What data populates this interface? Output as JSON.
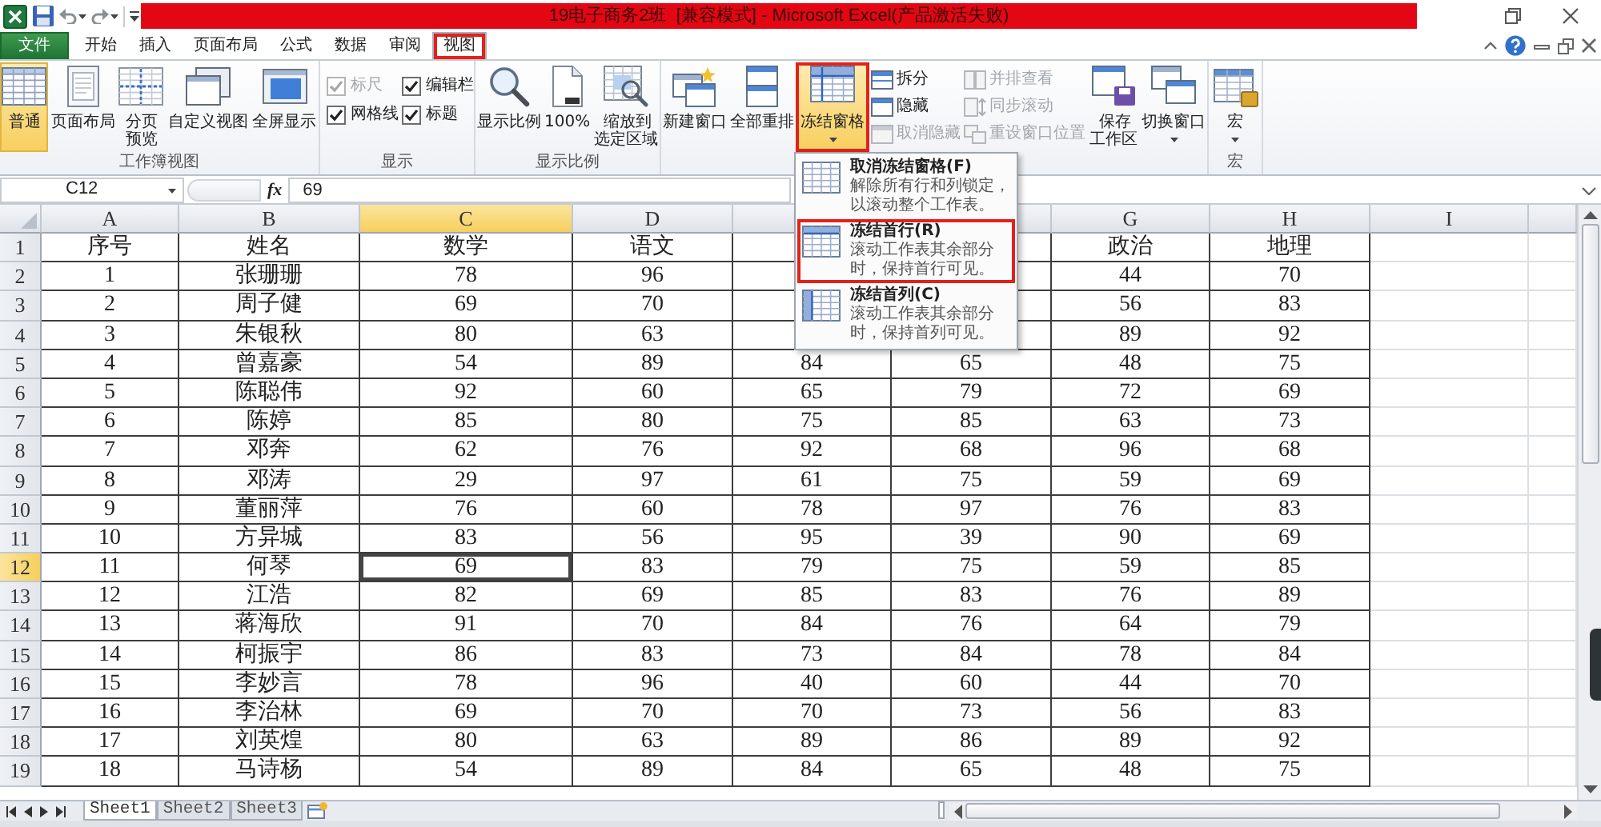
{
  "title_bar": {
    "title": "19电子商务2班  [兼容模式] - Microsoft Excel(产品激活失败)"
  },
  "ribbon_tabs": [
    {
      "kind": "file",
      "label": "文件",
      "selected": false,
      "annotated": false
    },
    {
      "kind": "tab",
      "label": "开始",
      "selected": false,
      "annotated": false
    },
    {
      "kind": "tab",
      "label": "插入",
      "selected": false,
      "annotated": false
    },
    {
      "kind": "tab",
      "label": "页面布局",
      "selected": false,
      "annotated": false
    },
    {
      "kind": "tab",
      "label": "公式",
      "selected": false,
      "annotated": false
    },
    {
      "kind": "tab",
      "label": "数据",
      "selected": false,
      "annotated": false
    },
    {
      "kind": "tab",
      "label": "审阅",
      "selected": false,
      "annotated": false
    },
    {
      "kind": "tab",
      "label": "视图",
      "selected": true,
      "annotated": true
    }
  ],
  "ribbon_groups": [
    {
      "label": "工作簿视图",
      "items": [
        {
          "kind": "large",
          "label": "普通",
          "active": true
        },
        {
          "kind": "large",
          "label": "页面布局",
          "active": false
        },
        {
          "kind": "large",
          "label": "分页预览",
          "active": false
        },
        {
          "kind": "large",
          "label": "自定义视图",
          "active": false
        },
        {
          "kind": "large",
          "label": "全屏显示",
          "active": false
        }
      ]
    },
    {
      "label": "显示",
      "items": [
        {
          "kind": "check",
          "label": "标尺",
          "checked": true,
          "disabled": true
        },
        {
          "kind": "check",
          "label": "编辑栏",
          "checked": true,
          "disabled": false
        },
        {
          "kind": "check",
          "label": "网格线",
          "checked": true,
          "disabled": false
        },
        {
          "kind": "check",
          "label": "标题",
          "checked": true,
          "disabled": false
        }
      ]
    },
    {
      "label": "显示比例",
      "items": [
        {
          "kind": "large",
          "label": "显示比例"
        },
        {
          "kind": "large",
          "label": "100%"
        },
        {
          "kind": "large",
          "label": "缩放到选定区域"
        }
      ]
    },
    {
      "items": [
        {
          "kind": "large",
          "label": "新建窗口",
          "active": false,
          "disabled": false,
          "annotated": false
        },
        {
          "kind": "large",
          "label": "全部重排",
          "active": false,
          "disabled": false,
          "annotated": false
        },
        {
          "kind": "menu",
          "label": "冻结窗格",
          "active": true,
          "disabled": false,
          "annotated": true
        },
        {
          "kind": "small",
          "label": "拆分",
          "active": false,
          "disabled": false,
          "annotated": false
        },
        {
          "kind": "small",
          "label": "隐藏",
          "active": false,
          "disabled": false,
          "annotated": false
        },
        {
          "kind": "small",
          "label": "取消隐藏",
          "active": false,
          "disabled": true,
          "annotated": false
        },
        {
          "kind": "small",
          "label": "并排查看",
          "active": false,
          "disabled": true,
          "annotated": false
        },
        {
          "kind": "small",
          "label": "同步滚动",
          "active": false,
          "disabled": true,
          "annotated": false
        },
        {
          "kind": "small",
          "label": "重设窗口位置",
          "active": false,
          "disabled": true,
          "annotated": false
        },
        {
          "kind": "large",
          "label": "保存工作区",
          "active": false,
          "disabled": false,
          "annotated": false
        },
        {
          "kind": "menu",
          "label": "切换窗口",
          "active": false,
          "disabled": false,
          "annotated": false
        }
      ]
    },
    {
      "label": "宏",
      "items": [
        {
          "kind": "menu",
          "label": "宏"
        }
      ]
    }
  ],
  "formula_bar": {
    "name_box": "C12",
    "function_label": "fx",
    "formula": "69"
  },
  "freeze_menu": {
    "items": [
      {
        "title": "取消冻结窗格(F)",
        "description": "解除所有行和列锁定，以滚动整个工作表。",
        "annotated": false
      },
      {
        "title": "冻结首行(R)",
        "description": "滚动工作表其余部分时，保持首行可见。",
        "annotated": true
      },
      {
        "title": "冻结首列(C)",
        "description": "滚动工作表其余部分时，保持首列可见。",
        "annotated": false
      }
    ]
  },
  "sheet": {
    "columns": [
      {
        "label": "A",
        "selected": false
      },
      {
        "label": "B",
        "selected": false
      },
      {
        "label": "C",
        "selected": true
      },
      {
        "label": "D",
        "selected": false
      },
      {
        "selected": false
      },
      {
        "selected": false
      },
      {
        "label": "G",
        "selected": false
      },
      {
        "label": "H",
        "selected": false
      },
      {
        "label": "I",
        "selected": false
      }
    ],
    "rows": [
      {
        "label": "1",
        "selected": false,
        "cells": [
          "序号",
          "姓名",
          "数学",
          "语文",
          null,
          null,
          "政治",
          "地理"
        ]
      },
      {
        "label": "2",
        "selected": false,
        "cells": [
          "1",
          "张珊珊",
          "78",
          "96",
          null,
          null,
          "44",
          "70"
        ]
      },
      {
        "label": "3",
        "selected": false,
        "cells": [
          "2",
          "周子健",
          "69",
          "70",
          null,
          null,
          "56",
          "83"
        ]
      },
      {
        "label": "4",
        "selected": false,
        "cells": [
          "3",
          "朱银秋",
          "80",
          "63",
          null,
          null,
          "89",
          "92"
        ]
      },
      {
        "label": "5",
        "selected": false,
        "cells": [
          "4",
          "曾嘉豪",
          "54",
          "89",
          "84",
          "65",
          "48",
          "75"
        ]
      },
      {
        "label": "6",
        "selected": false,
        "cells": [
          "5",
          "陈聪伟",
          "92",
          "60",
          "65",
          "79",
          "72",
          "69"
        ]
      },
      {
        "label": "7",
        "selected": false,
        "cells": [
          "6",
          "陈婷",
          "85",
          "80",
          "75",
          "85",
          "63",
          "73"
        ]
      },
      {
        "label": "8",
        "selected": false,
        "cells": [
          "7",
          "邓奔",
          "62",
          "76",
          "92",
          "68",
          "96",
          "68"
        ]
      },
      {
        "label": "9",
        "selected": false,
        "cells": [
          "8",
          "邓涛",
          "29",
          "97",
          "61",
          "75",
          "59",
          "69"
        ]
      },
      {
        "label": "10",
        "selected": false,
        "cells": [
          "9",
          "董丽萍",
          "76",
          "60",
          "78",
          "97",
          "76",
          "83"
        ]
      },
      {
        "label": "11",
        "selected": false,
        "cells": [
          "10",
          "方异城",
          "83",
          "56",
          "95",
          "39",
          "90",
          "69"
        ]
      },
      {
        "label": "12",
        "selected": true,
        "cells": [
          "11",
          "何琴",
          "69",
          "83",
          "79",
          "75",
          "59",
          "85"
        ]
      },
      {
        "label": "13",
        "selected": false,
        "cells": [
          "12",
          "江浩",
          "82",
          "69",
          "85",
          "83",
          "76",
          "89"
        ]
      },
      {
        "label": "14",
        "selected": false,
        "cells": [
          "13",
          "蒋海欣",
          "91",
          "70",
          "84",
          "76",
          "64",
          "79"
        ]
      },
      {
        "label": "15",
        "selected": false,
        "cells": [
          "14",
          "柯振宇",
          "86",
          "83",
          "73",
          "84",
          "78",
          "84"
        ]
      },
      {
        "label": "16",
        "selected": false,
        "cells": [
          "15",
          "李妙言",
          "78",
          "96",
          "40",
          "60",
          "44",
          "70"
        ]
      },
      {
        "label": "17",
        "selected": false,
        "cells": [
          "16",
          "李治林",
          "69",
          "70",
          "70",
          "73",
          "56",
          "83"
        ]
      },
      {
        "label": "18",
        "selected": false,
        "cells": [
          "17",
          "刘英煌",
          "80",
          "63",
          "89",
          "86",
          "89",
          "92"
        ]
      },
      {
        "label": "19",
        "selected": false,
        "cells": [
          "18",
          "马诗杨",
          "54",
          "89",
          "84",
          "65",
          "48",
          "75"
        ]
      }
    ]
  },
  "sheet_tabs": [
    {
      "label": "Sheet1",
      "selected": true
    },
    {
      "label": "Sheet2",
      "selected": false
    },
    {
      "label": "Sheet3",
      "selected": false
    }
  ]
}
